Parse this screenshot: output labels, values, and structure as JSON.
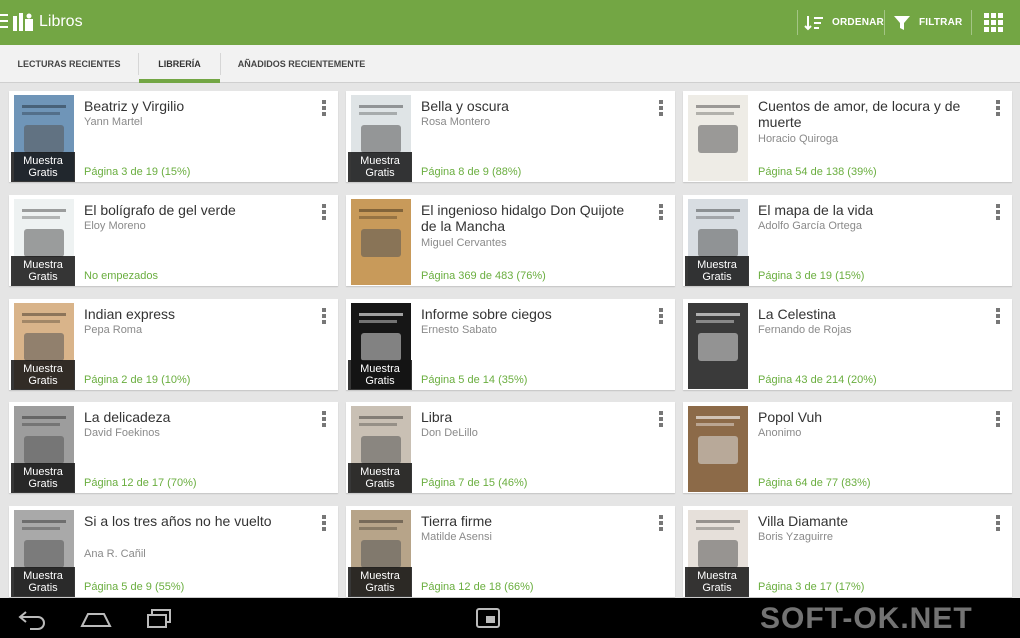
{
  "actionbar": {
    "title": "Libros",
    "sort_label": "ORDENAR",
    "filter_label": "FILTRAR",
    "accent_color": "#73a644"
  },
  "tabs": [
    {
      "label": "LECTURAS RECIENTES",
      "selected": false
    },
    {
      "label": "LIBRERÍA",
      "selected": true
    },
    {
      "label": "AÑADIDOS RECIENTEMENTE",
      "selected": false
    }
  ],
  "sample_badge": "Muestra Gratis",
  "books": [
    {
      "title": "Beatriz y Virgilio",
      "author": "Yann Martel",
      "progress": "Página 3 de 19 (15%)",
      "sample": true,
      "cover_color": "#6f95b8"
    },
    {
      "title": "Bella y oscura",
      "author": "Rosa Montero",
      "progress": "Página 8 de 9 (88%)",
      "sample": true,
      "cover_color": "#dfe4e6"
    },
    {
      "title": "Cuentos de amor, de locura y de muerte",
      "author": "Horacio Quiroga",
      "progress": "Página 54 de 138 (39%)",
      "sample": false,
      "cover_color": "#eeece6"
    },
    {
      "title": "El bolígrafo de gel verde",
      "author": "Eloy Moreno",
      "progress": "No empezados",
      "sample": true,
      "cover_color": "#eef2f2"
    },
    {
      "title": "El ingenioso hidalgo Don Quijote de la Mancha",
      "author": "Miguel Cervantes",
      "progress": "Página 369 de 483 (76%)",
      "sample": false,
      "cover_color": "#c89a5a"
    },
    {
      "title": "El mapa de la vida",
      "author": "Adolfo García Ortega",
      "progress": "Página 3 de 19 (15%)",
      "sample": true,
      "cover_color": "#d8dde2"
    },
    {
      "title": "Indian express",
      "author": "Pepa Roma",
      "progress": "Página 2 de 19 (10%)",
      "sample": true,
      "cover_color": "#d9b48a"
    },
    {
      "title": "Informe sobre ciegos",
      "author": "Ernesto Sabato",
      "progress": "Página 5 de 14 (35%)",
      "sample": true,
      "cover_color": "#161616"
    },
    {
      "title": "La Celestina",
      "author": "Fernando de Rojas",
      "progress": "Página 43 de 214 (20%)",
      "sample": false,
      "cover_color": "#3a3a3a"
    },
    {
      "title": "La delicadeza",
      "author": "David Foekinos",
      "progress": "Página 12 de 17 (70%)",
      "sample": true,
      "cover_color": "#9d9d9d"
    },
    {
      "title": "Libra",
      "author": "Don DeLillo",
      "progress": "Página 7 de 15 (46%)",
      "sample": true,
      "cover_color": "#c9c0b4"
    },
    {
      "title": "Popol Vuh",
      "author": "Anonimo",
      "progress": "Página 64 de 77 (83%)",
      "sample": false,
      "cover_color": "#8c6a48"
    },
    {
      "title": "Si a los tres años no he vuelto",
      "author": "Ana R. Cañil",
      "progress": "Página 5 de 9 (55%)",
      "sample": true,
      "cover_color": "#a9a9a9"
    },
    {
      "title": "Tierra firme",
      "author": "Matilde Asensi",
      "progress": "Página 12 de 18 (66%)",
      "sample": true,
      "cover_color": "#b7a489"
    },
    {
      "title": "Villa Diamante",
      "author": "Boris Yzaguirre",
      "progress": "Página 3 de 17 (17%)",
      "sample": true,
      "cover_color": "#e6e0da"
    }
  ],
  "watermark": "SOFT-OK.NET"
}
